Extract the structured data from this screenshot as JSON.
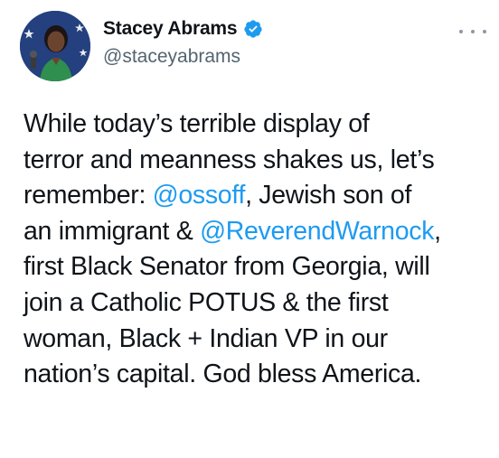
{
  "author": {
    "display_name": "Stacey Abrams",
    "handle": "@staceyabrams",
    "verified": true,
    "verified_icon": "verified-badge-icon",
    "avatar_icon": "profile-photo"
  },
  "menu": {
    "icon": "more-options-icon"
  },
  "tweet": {
    "lines": [
      {
        "segments": [
          {
            "text": "While today’s terrible display of",
            "mention": false
          }
        ]
      },
      {
        "segments": [
          {
            "text": "terror and meanness shakes us, let’s",
            "mention": false
          }
        ]
      },
      {
        "segments": [
          {
            "text": "remember: ",
            "mention": false
          },
          {
            "text": "@ossoff",
            "mention": true
          },
          {
            "text": ", Jewish son of",
            "mention": false
          }
        ]
      },
      {
        "segments": [
          {
            "text": "an immigrant & ",
            "mention": false
          },
          {
            "text": "@ReverendWarnock",
            "mention": true
          },
          {
            "text": ",",
            "mention": false
          }
        ]
      },
      {
        "segments": [
          {
            "text": "first Black Senator from Georgia, will",
            "mention": false
          }
        ]
      },
      {
        "segments": [
          {
            "text": "join a Catholic POTUS & the first",
            "mention": false
          }
        ]
      },
      {
        "segments": [
          {
            "text": "woman, Black + Indian VP in our",
            "mention": false
          }
        ]
      },
      {
        "segments": [
          {
            "text": "nation’s capital. God bless America.",
            "mention": false
          }
        ]
      }
    ]
  },
  "colors": {
    "text": "#0f1419",
    "secondary": "#536471",
    "link": "#1d9bf0",
    "verified": "#1d9bf0"
  }
}
